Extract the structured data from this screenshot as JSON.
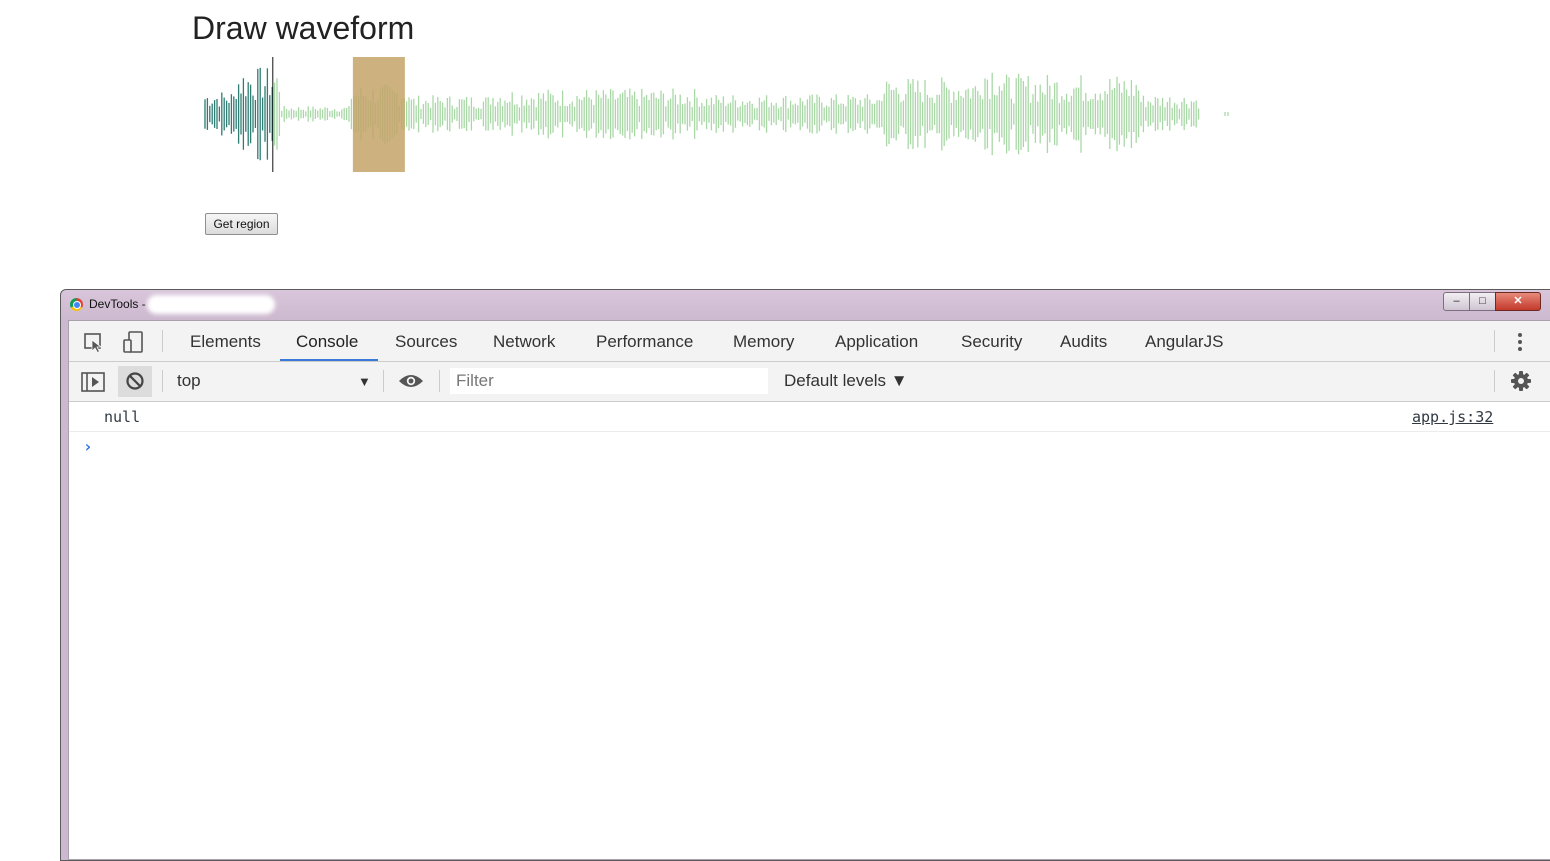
{
  "page": {
    "title": "Draw waveform",
    "get_region_label": "Get region"
  },
  "colors": {
    "played": "#2e7c72",
    "unplayed": "#a9d8a6",
    "region": "#c4a46a",
    "cursor": "#111111",
    "tab_accent": "#3879d9"
  },
  "waveform": {
    "played_fraction": 0.07,
    "region_start_fraction": 0.147,
    "region_end_fraction": 0.197
  },
  "devtools": {
    "window_title": "DevTools -",
    "window_buttons": {
      "minimize": "–",
      "maximize": "□",
      "close": "✕"
    },
    "tools": [
      {
        "name": "inspect-icon"
      },
      {
        "name": "device-toggle-icon"
      }
    ],
    "tabs": [
      "Elements",
      "Console",
      "Sources",
      "Network",
      "Performance",
      "Memory",
      "Application",
      "Security",
      "Audits",
      "AngularJS"
    ],
    "active_tab": "Console",
    "console_toolbar": {
      "context": "top",
      "filter_placeholder": "Filter",
      "levels": "Default levels ▼"
    },
    "log": {
      "message": "null",
      "source": "app.js:32",
      "prompt": "›"
    }
  }
}
